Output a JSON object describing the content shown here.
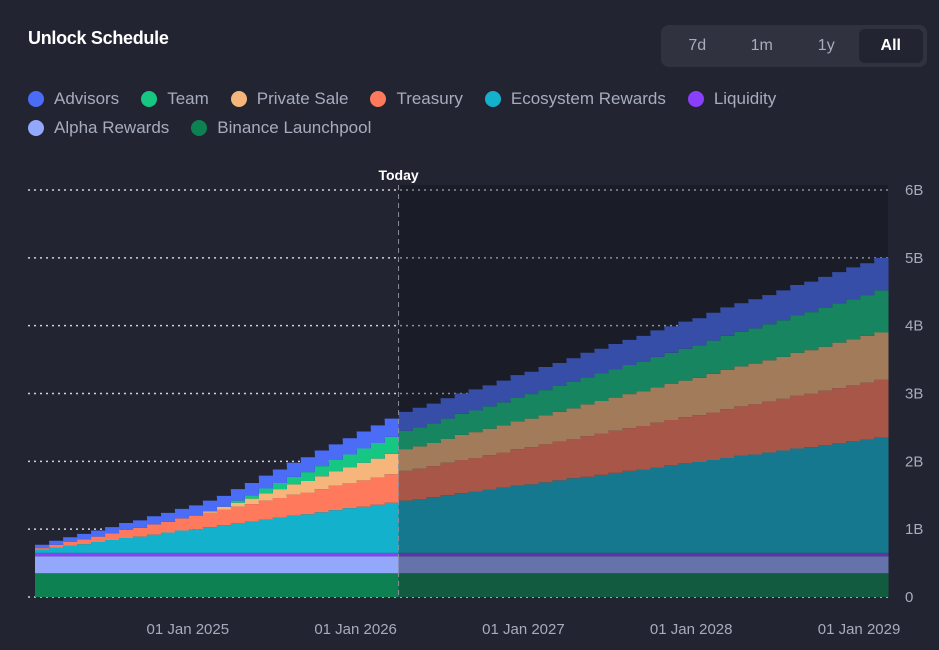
{
  "header": {
    "title": "Unlock Schedule",
    "ranges": [
      "7d",
      "1m",
      "1y",
      "All"
    ],
    "active_range": "All"
  },
  "chart_data": {
    "type": "area",
    "title": "Unlock Schedule",
    "x_start": "Feb 2024",
    "x_step": "1 month",
    "today_index": 26,
    "today_label": "Today",
    "x_ticks": [
      {
        "index": 11,
        "label": "01 Jan 2025"
      },
      {
        "index": 23,
        "label": "01 Jan 2026"
      },
      {
        "index": 35,
        "label": "01 Jan 2027"
      },
      {
        "index": 47,
        "label": "01 Jan 2028"
      },
      {
        "index": 59,
        "label": "01 Jan 2029"
      }
    ],
    "y_ticks": [
      {
        "v": 0,
        "label": "0"
      },
      {
        "v": 1,
        "label": "1B"
      },
      {
        "v": 2,
        "label": "2B"
      },
      {
        "v": 3,
        "label": "3B"
      },
      {
        "v": 4,
        "label": "4B"
      },
      {
        "v": 5,
        "label": "5B"
      },
      {
        "v": 6,
        "label": "6B"
      }
    ],
    "ylim": [
      0,
      6
    ],
    "y_unit": "B tokens",
    "grid": true,
    "stacked": true,
    "legend_position": "top-left",
    "series": [
      {
        "name": "Binance Launchpool",
        "color": "#0e8152",
        "constant": 0.35
      },
      {
        "name": "Alpha Rewards",
        "color": "#93a8fb",
        "constant": 0.25
      },
      {
        "name": "Liquidity",
        "color": "#8a3ffc",
        "constant": 0.05
      },
      {
        "name": "Ecosystem Rewards",
        "color": "#14b1cd",
        "values": [
          0.05,
          0.08,
          0.11,
          0.13,
          0.16,
          0.19,
          0.22,
          0.24,
          0.27,
          0.3,
          0.33,
          0.35,
          0.38,
          0.41,
          0.44,
          0.46,
          0.49,
          0.52,
          0.55,
          0.57,
          0.6,
          0.63,
          0.66,
          0.68,
          0.71,
          0.74,
          0.77,
          0.79,
          0.82,
          0.85,
          0.88,
          0.9,
          0.93,
          0.96,
          0.99,
          1.01,
          1.04,
          1.07,
          1.1,
          1.12,
          1.15,
          1.18,
          1.21,
          1.23,
          1.26,
          1.29,
          1.32,
          1.34,
          1.37,
          1.4,
          1.43,
          1.45,
          1.48,
          1.51,
          1.54,
          1.56,
          1.59,
          1.62,
          1.65,
          1.67,
          1.7
        ]
      },
      {
        "name": "Treasury",
        "color": "#ff7a5c",
        "values": [
          0.02,
          0.04,
          0.05,
          0.07,
          0.08,
          0.1,
          0.12,
          0.13,
          0.15,
          0.16,
          0.18,
          0.2,
          0.21,
          0.23,
          0.24,
          0.26,
          0.28,
          0.29,
          0.31,
          0.32,
          0.34,
          0.36,
          0.37,
          0.39,
          0.4,
          0.42,
          0.44,
          0.45,
          0.46,
          0.48,
          0.49,
          0.5,
          0.51,
          0.52,
          0.54,
          0.55,
          0.56,
          0.57,
          0.58,
          0.6,
          0.61,
          0.62,
          0.63,
          0.64,
          0.66,
          0.67,
          0.68,
          0.69,
          0.7,
          0.72,
          0.73,
          0.74,
          0.75,
          0.76,
          0.78,
          0.79,
          0.8,
          0.81,
          0.82,
          0.84,
          0.85
        ]
      },
      {
        "name": "Private Sale",
        "color": "#f5b57b",
        "values": [
          0,
          0,
          0,
          0,
          0,
          0,
          0,
          0,
          0,
          0,
          0,
          0,
          0.02,
          0.04,
          0.06,
          0.08,
          0.11,
          0.13,
          0.15,
          0.17,
          0.19,
          0.21,
          0.23,
          0.26,
          0.28,
          0.3,
          0.32,
          0.33,
          0.34,
          0.35,
          0.37,
          0.38,
          0.39,
          0.4,
          0.41,
          0.42,
          0.43,
          0.44,
          0.45,
          0.47,
          0.48,
          0.49,
          0.5,
          0.51,
          0.52,
          0.53,
          0.54,
          0.55,
          0.57,
          0.58,
          0.59,
          0.6,
          0.61,
          0.62,
          0.63,
          0.64,
          0.65,
          0.67,
          0.68,
          0.69,
          0.7
        ]
      },
      {
        "name": "Team",
        "color": "#16c784",
        "values": [
          0,
          0,
          0,
          0,
          0,
          0,
          0,
          0,
          0,
          0,
          0,
          0,
          0,
          0,
          0.03,
          0.05,
          0.07,
          0.09,
          0.11,
          0.13,
          0.15,
          0.17,
          0.19,
          0.21,
          0.23,
          0.25,
          0.27,
          0.28,
          0.29,
          0.3,
          0.31,
          0.32,
          0.33,
          0.34,
          0.35,
          0.36,
          0.37,
          0.38,
          0.39,
          0.4,
          0.41,
          0.42,
          0.43,
          0.44,
          0.45,
          0.46,
          0.47,
          0.48,
          0.49,
          0.5,
          0.51,
          0.52,
          0.53,
          0.54,
          0.55,
          0.56,
          0.57,
          0.58,
          0.59,
          0.6,
          0.62
        ]
      },
      {
        "name": "Advisors",
        "color": "#4a6cf7",
        "values": [
          0.05,
          0.06,
          0.07,
          0.08,
          0.09,
          0.09,
          0.1,
          0.11,
          0.12,
          0.13,
          0.14,
          0.15,
          0.16,
          0.16,
          0.17,
          0.18,
          0.19,
          0.2,
          0.21,
          0.22,
          0.23,
          0.23,
          0.24,
          0.25,
          0.26,
          0.27,
          0.28,
          0.29,
          0.29,
          0.3,
          0.3,
          0.31,
          0.31,
          0.32,
          0.33,
          0.33,
          0.34,
          0.34,
          0.35,
          0.36,
          0.36,
          0.37,
          0.37,
          0.38,
          0.39,
          0.39,
          0.4,
          0.4,
          0.41,
          0.42,
          0.42,
          0.43,
          0.43,
          0.44,
          0.45,
          0.45,
          0.46,
          0.46,
          0.47,
          0.47,
          0.48
        ]
      }
    ],
    "legend": [
      {
        "name": "Advisors",
        "color": "#4a6cf7"
      },
      {
        "name": "Team",
        "color": "#16c784"
      },
      {
        "name": "Private Sale",
        "color": "#f5b57b"
      },
      {
        "name": "Treasury",
        "color": "#ff7a5c"
      },
      {
        "name": "Ecosystem Rewards",
        "color": "#14b1cd"
      },
      {
        "name": "Liquidity",
        "color": "#8a3ffc"
      },
      {
        "name": "Alpha Rewards",
        "color": "#93a8fb"
      },
      {
        "name": "Binance Launchpool",
        "color": "#0e8152"
      }
    ]
  }
}
